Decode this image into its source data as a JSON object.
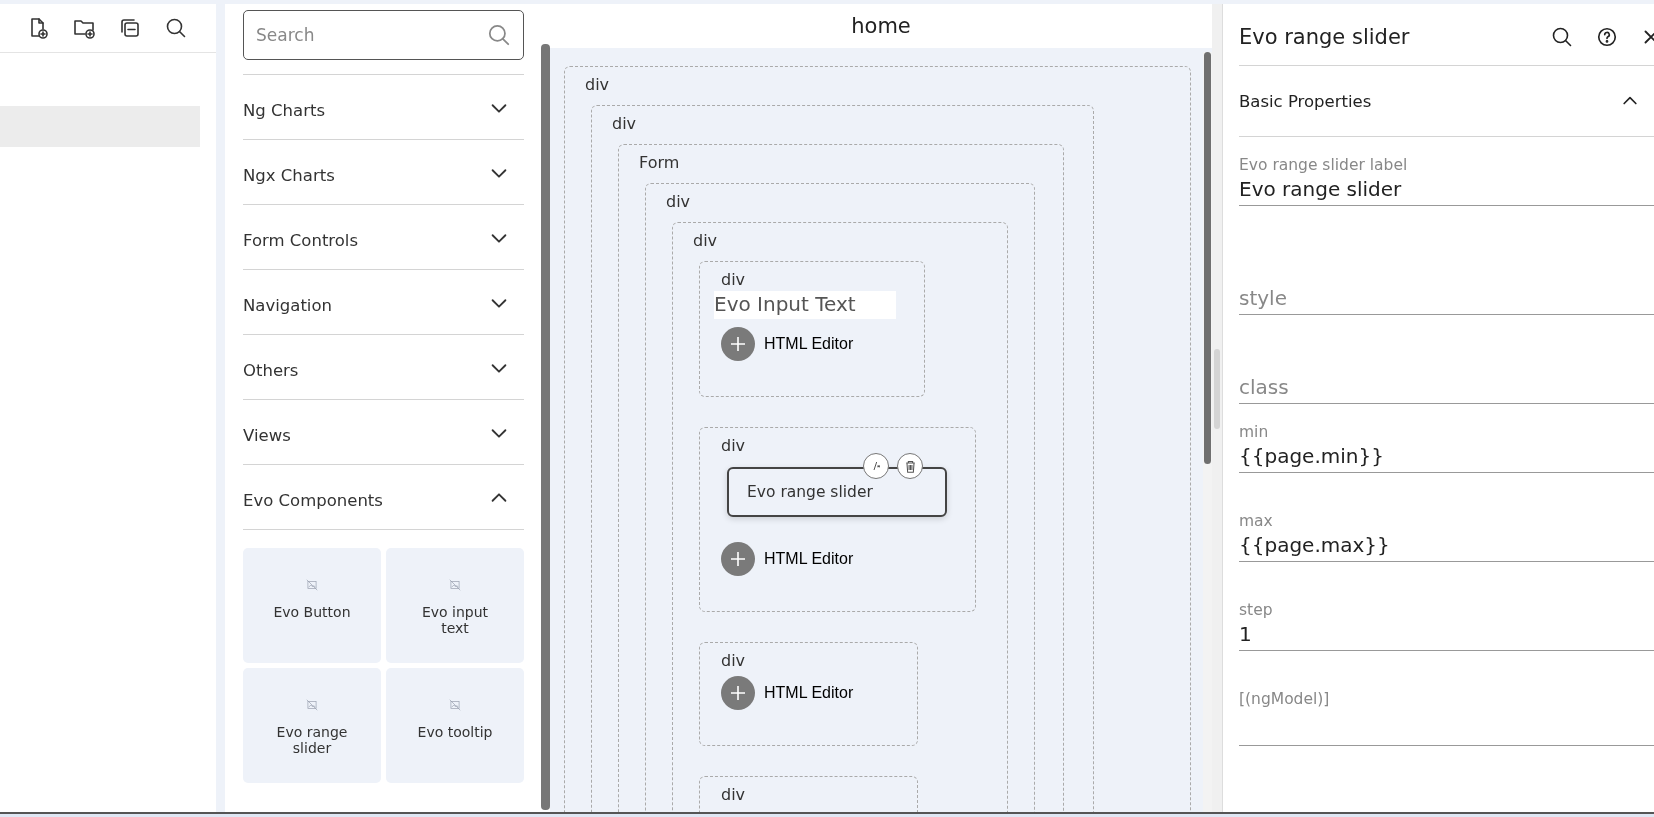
{
  "explorer": {
    "items": [
      {
        "selected": true
      }
    ]
  },
  "palette": {
    "search": {
      "placeholder": "Search"
    },
    "categories": [
      {
        "label": "Ng Charts",
        "expanded": false
      },
      {
        "label": "Ngx Charts",
        "expanded": false
      },
      {
        "label": "Form Controls",
        "expanded": false
      },
      {
        "label": "Navigation",
        "expanded": false
      },
      {
        "label": "Others",
        "expanded": false
      },
      {
        "label": "Views",
        "expanded": false
      },
      {
        "label": "Evo Components",
        "expanded": true
      }
    ],
    "components": [
      {
        "label": "Evo Button"
      },
      {
        "label": "Evo input text"
      },
      {
        "label": "Evo range slider"
      },
      {
        "label": "Evo tooltip"
      }
    ]
  },
  "canvas": {
    "title": "home",
    "tree": [
      {
        "label": "div",
        "children": [
          {
            "label": "div",
            "children": [
              {
                "label": "Form",
                "children": [
                  {
                    "label": "div",
                    "children": [
                      {
                        "label": "div",
                        "children": [
                          {
                            "label": "div",
                            "children": [
                              {
                                "kind": "input-text",
                                "text": "Evo Input Text"
                              },
                              {
                                "kind": "html-editor",
                                "text": "HTML Editor"
                              }
                            ]
                          },
                          {
                            "label": "div",
                            "children": [
                              {
                                "kind": "range-slider",
                                "text": "Evo range slider",
                                "selected": true
                              },
                              {
                                "kind": "html-editor",
                                "text": "HTML Editor"
                              }
                            ]
                          },
                          {
                            "label": "div",
                            "children": [
                              {
                                "kind": "html-editor",
                                "text": "HTML Editor"
                              }
                            ]
                          },
                          {
                            "label": "div"
                          }
                        ]
                      }
                    ]
                  }
                ]
              }
            ]
          }
        ]
      }
    ]
  },
  "properties": {
    "title": "Evo range slider",
    "section": {
      "title": "Basic Properties",
      "expanded": true
    },
    "fields": [
      {
        "label": "Evo range slider label",
        "value": "Evo range slider"
      },
      {
        "placeholder": "style"
      },
      {
        "placeholder": "class"
      },
      {
        "label": "min",
        "value": "{{page.min}}"
      },
      {
        "label": "max",
        "value": "{{page.max}}"
      },
      {
        "label": "step",
        "value": "1"
      },
      {
        "label": "[(ngModel)]"
      }
    ]
  }
}
